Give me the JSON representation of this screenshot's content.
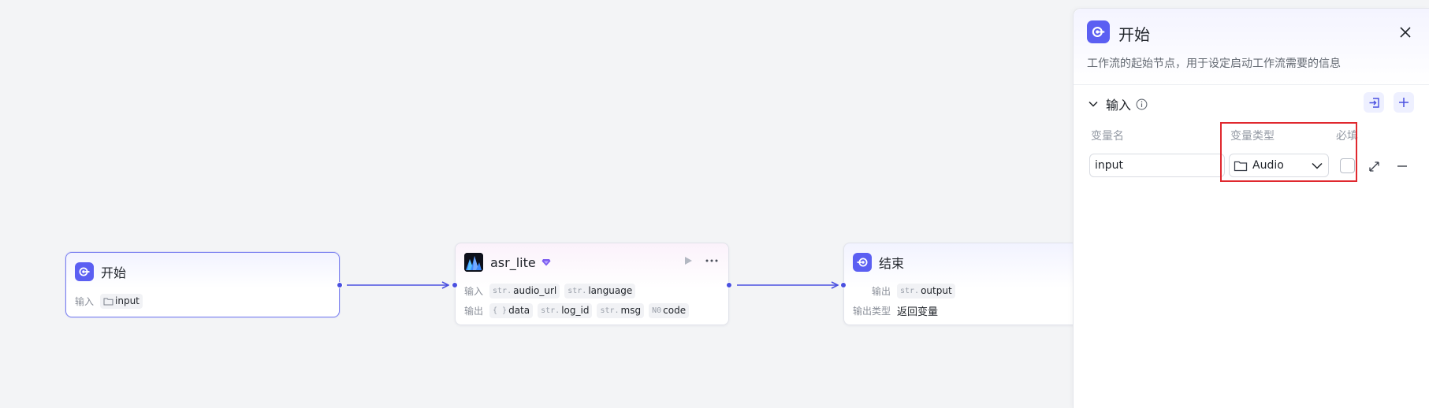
{
  "canvas": {
    "nodes": {
      "start": {
        "title": "开始",
        "input_label": "输入",
        "input_tag": "input"
      },
      "asr": {
        "title": "asr_lite",
        "input_label": "输入",
        "output_label": "输出",
        "inputs": [
          {
            "type": "str.",
            "name": "audio_url"
          },
          {
            "type": "str.",
            "name": "language"
          }
        ],
        "outputs": [
          {
            "type": "{ }",
            "name": "data"
          },
          {
            "type": "str.",
            "name": "log_id"
          },
          {
            "type": "str.",
            "name": "msg"
          },
          {
            "type": "N0",
            "name": "code"
          }
        ]
      },
      "end": {
        "title": "结束",
        "output_label": "输出",
        "output_tag_type": "str.",
        "output_tag": "output",
        "output_type_label": "输出类型",
        "output_type_value": "返回变量"
      }
    }
  },
  "panel": {
    "title": "开始",
    "description": "工作流的起始节点，用于设定启动工作流需要的信息",
    "section_title": "输入",
    "columns": {
      "name": "变量名",
      "type": "变量类型",
      "required": "必填"
    },
    "variables": [
      {
        "name": "input",
        "type": "Audio",
        "required": false
      }
    ]
  },
  "colors": {
    "accent": "#5b5ff2",
    "edge": "#4a50e0",
    "highlight": "#e0282e"
  },
  "icons": {
    "start": "start-node-icon",
    "end": "end-node-icon",
    "asr": "asr-plugin-icon",
    "vip": "diamond-icon",
    "run": "play-icon",
    "more": "more-icon",
    "close": "close-icon",
    "collapse": "chevron-down-icon",
    "info": "info-icon",
    "import": "import-icon",
    "add": "plus-icon",
    "folder": "folder-icon",
    "dropdown": "chevron-down-icon",
    "expand": "expand-icon",
    "remove": "minus-icon"
  }
}
